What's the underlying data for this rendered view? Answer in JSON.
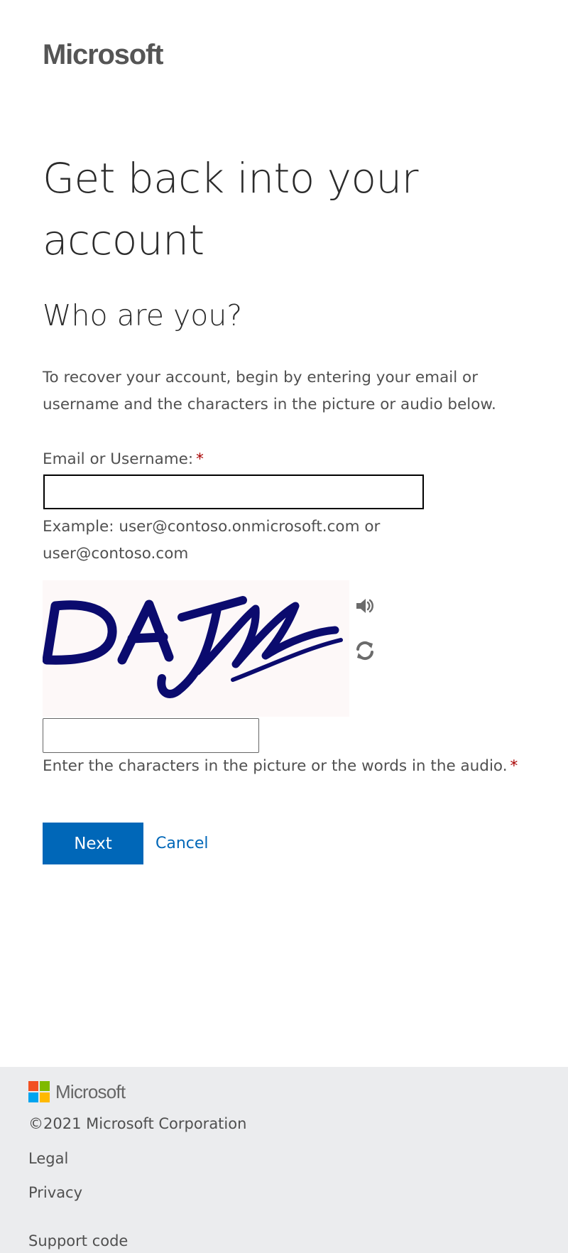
{
  "header": {
    "logo_text": "Microsoft"
  },
  "main": {
    "title": "Get back into your account",
    "subtitle": "Who are you?",
    "intro": "To recover your account, begin by entering your email or username and the characters in the picture or audio below.",
    "email_label": "Email or Username:",
    "required_mark": "*",
    "email_value": "",
    "email_example": "Example: user@contoso.onmicrosoft.com or user@contoso.com",
    "captcha_text": "DAJM",
    "captcha_value": "",
    "captcha_hint": "Enter the characters in the picture or the words in the audio.",
    "next_label": "Next",
    "cancel_label": "Cancel"
  },
  "icons": {
    "audio": "speaker-icon",
    "refresh": "refresh-icon"
  },
  "colors": {
    "accent": "#0067b8",
    "required": "#a80000",
    "captcha_ink": "#0b0b6e",
    "footer_bg": "#ebecee",
    "logo_red": "#f25022",
    "logo_green": "#7fba00",
    "logo_blue": "#00a4ef",
    "logo_yellow": "#ffb900"
  },
  "footer": {
    "logo_text": "Microsoft",
    "copyright": "©2021 Microsoft Corporation",
    "legal": "Legal",
    "privacy": "Privacy",
    "support_code": "Support code"
  }
}
